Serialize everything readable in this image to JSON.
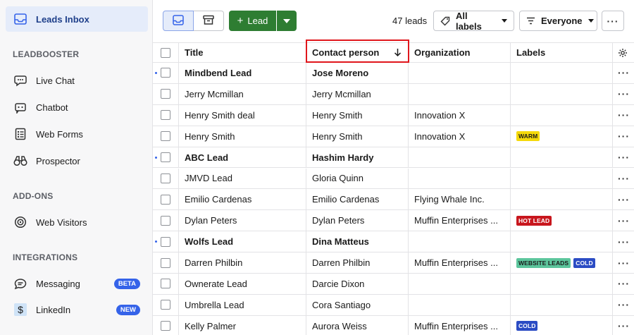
{
  "sidebar": {
    "inbox_label": "Leads Inbox",
    "section_leadbooster": "LEADBOOSTER",
    "live_chat": "Live Chat",
    "chatbot": "Chatbot",
    "web_forms": "Web Forms",
    "prospector": "Prospector",
    "section_addons": "ADD-ONS",
    "web_visitors": "Web Visitors",
    "section_integrations": "INTEGRATIONS",
    "messaging": "Messaging",
    "messaging_badge": "BETA",
    "linkedin": "LinkedIn",
    "linkedin_badge": "NEW"
  },
  "toolbar": {
    "add_lead": "Lead",
    "lead_count": "47 leads",
    "labels_filter": "All labels",
    "owner_filter": "Everyone"
  },
  "table": {
    "headers": {
      "title": "Title",
      "contact": "Contact person",
      "organization": "Organization",
      "labels": "Labels"
    },
    "rows": [
      {
        "title": "Mindbend Lead",
        "contact": "Jose Moreno",
        "org": "",
        "unread": true,
        "labels": []
      },
      {
        "title": "Jerry Mcmillan",
        "contact": "Jerry Mcmillan",
        "org": "",
        "unread": false,
        "labels": []
      },
      {
        "title": "Henry Smith deal",
        "contact": "Henry Smith",
        "org": "Innovation X",
        "unread": false,
        "labels": []
      },
      {
        "title": "Henry Smith",
        "contact": "Henry Smith",
        "org": "Innovation X",
        "unread": false,
        "labels": [
          {
            "text": "WARM",
            "bg": "#f5d90a",
            "fg": "#1a1a1a"
          }
        ]
      },
      {
        "title": "ABC Lead",
        "contact": "Hashim Hardy",
        "org": "",
        "unread": true,
        "labels": []
      },
      {
        "title": "JMVD Lead",
        "contact": "Gloria Quinn",
        "org": "",
        "unread": false,
        "labels": []
      },
      {
        "title": "Emilio Cardenas",
        "contact": "Emilio Cardenas",
        "org": "Flying Whale Inc.",
        "unread": false,
        "labels": []
      },
      {
        "title": "Dylan Peters",
        "contact": "Dylan Peters",
        "org": "Muffin Enterprises ...",
        "unread": false,
        "labels": [
          {
            "text": "HOT LEAD",
            "bg": "#c8161d",
            "fg": "#ffffff"
          }
        ]
      },
      {
        "title": "Wolfs Lead",
        "contact": "Dina Matteus",
        "org": "",
        "unread": true,
        "labels": []
      },
      {
        "title": "Darren Philbin",
        "contact": "Darren Philbin",
        "org": "Muffin Enterprises ...",
        "unread": false,
        "labels": [
          {
            "text": "WEBSITE LEADS",
            "bg": "#5cc59c",
            "fg": "#1a1a1a"
          },
          {
            "text": "COLD",
            "bg": "#2b4cc4",
            "fg": "#ffffff"
          }
        ]
      },
      {
        "title": "Ownerate Lead",
        "contact": "Darcie Dixon",
        "org": "",
        "unread": false,
        "labels": []
      },
      {
        "title": "Umbrella Lead",
        "contact": "Cora Santiago",
        "org": "",
        "unread": false,
        "labels": []
      },
      {
        "title": "Kelly Palmer",
        "contact": "Aurora Weiss",
        "org": "Muffin Enterprises ...",
        "unread": false,
        "labels": [
          {
            "text": "COLD",
            "bg": "#2b4cc4",
            "fg": "#ffffff"
          }
        ]
      }
    ]
  },
  "colors": {
    "accent": "#3563e9",
    "primary_button": "#2e7d32",
    "highlight_box": "#e0161c"
  }
}
